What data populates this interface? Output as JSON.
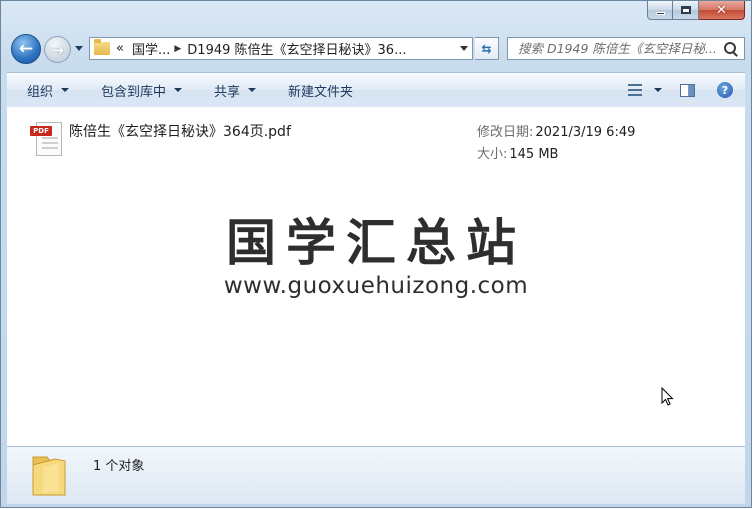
{
  "window": {
    "caption": {
      "minimize": "minimize",
      "maximize": "maximize",
      "close": "close"
    }
  },
  "address": {
    "overflow": "«",
    "segments": [
      "国学...",
      "D1949 陈倍生《玄空择日秘诀》36..."
    ],
    "search_placeholder": "搜索 D1949 陈倍生《玄空择日秘..."
  },
  "toolbar": {
    "organize": "组织",
    "include_library": "包含到库中",
    "share": "共享",
    "new_folder": "新建文件夹"
  },
  "file": {
    "name": "陈倍生《玄空择日秘诀》364页.pdf",
    "icon_tag": "PDF",
    "modified_label": "修改日期:",
    "modified_value": "2021/3/19 6:49",
    "size_label": "大小:",
    "size_value": "145 MB"
  },
  "watermark": {
    "title": "国学汇总站",
    "url": "www.guoxuehuizong.com"
  },
  "status": {
    "count_text": "1 个对象"
  },
  "colors": {
    "pdf_red": "#c7281b",
    "folder_yellow": "#e4b94a",
    "accent_blue": "#2c72c1"
  }
}
